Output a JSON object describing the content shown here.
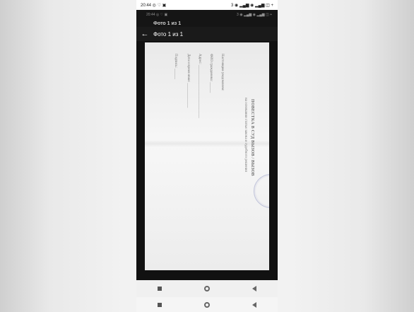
{
  "status_bar": {
    "time_icons": "20:44 ◎ ♡ ▣",
    "signal_battery": "3 ◉ ▂▄▆ ◉ ▂▄▆ ◫ +"
  },
  "ghost_header": {
    "time_icons": "20:44 ◎ ♡ ▣",
    "signal_battery": "3 ◉ ▂▄▆ ◉ ▂▄▆ ◫ +",
    "title": "Фото 1 из 1"
  },
  "viewer": {
    "title": "Фото 1 из 1",
    "back_icon": "←"
  },
  "document": {
    "heading": "ПОВЕСТКА В СУД ВЫЗОВ / ВЫЗОВ",
    "subheading": "на основании статьи закона и судебного решения",
    "lines": [
      "Настоящим уведомляем:",
      "ФИО гражданина: ______",
      "Адрес: ______________________________",
      "Дата и время явки: ______________",
      "Подпись: ______"
    ]
  },
  "nav": {
    "menu_icon": "square",
    "home_icon": "circle",
    "back_icon": "triangle"
  }
}
